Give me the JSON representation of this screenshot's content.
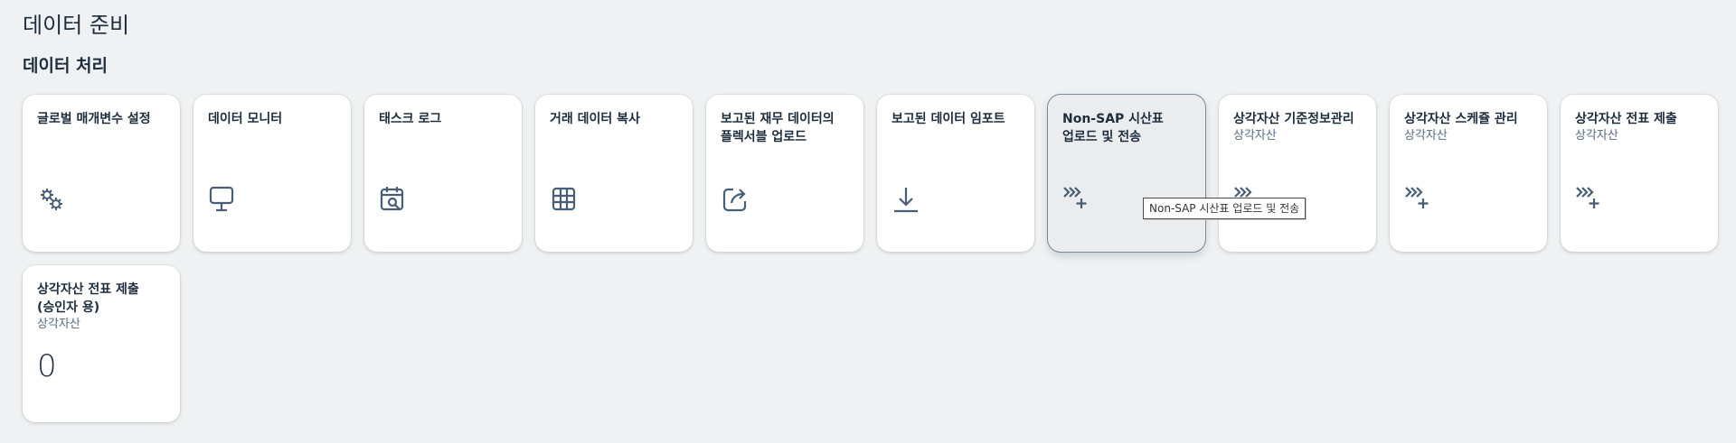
{
  "page": {
    "title": "데이터 준비",
    "section_title": "데이터 처리"
  },
  "tiles": [
    {
      "title": "글로벌 매개변수 설정",
      "subtitle": "",
      "icon": "gears-icon"
    },
    {
      "title": "데이터 모니터",
      "subtitle": "",
      "icon": "monitor-icon"
    },
    {
      "title": "태스크 로그",
      "subtitle": "",
      "icon": "calendar-search-icon"
    },
    {
      "title": "거래 데이터 복사",
      "subtitle": "",
      "icon": "table-grid-icon"
    },
    {
      "title": "보고된 재무 데이터의 플렉서블 업로드",
      "subtitle": "",
      "icon": "share-export-icon"
    },
    {
      "title": "보고된 데이터 임포트",
      "subtitle": "",
      "icon": "download-icon"
    },
    {
      "title": "Non-SAP 시산표 업로드 및 전송",
      "subtitle": "",
      "icon": "process-add-icon"
    },
    {
      "title": "상각자산 기준정보관리",
      "subtitle": "상각자산",
      "icon": "process-add-icon"
    },
    {
      "title": "상각자산 스케쥴 관리",
      "subtitle": "상각자산",
      "icon": "process-add-icon"
    },
    {
      "title": "상각자산 전표 제출",
      "subtitle": "상각자산",
      "icon": "process-add-icon"
    },
    {
      "title": "상각자산 전표 제출(승인자 용)",
      "subtitle": "상각자산",
      "kpi": "0"
    }
  ],
  "tooltip": {
    "text": "Non-SAP 시산표 업로드 및 전송"
  },
  "colors": {
    "background": "#f0f1f3",
    "tile": "#ffffff",
    "icon": "#475e75",
    "text": "#1d2d3e",
    "subtitle": "#556b82"
  }
}
